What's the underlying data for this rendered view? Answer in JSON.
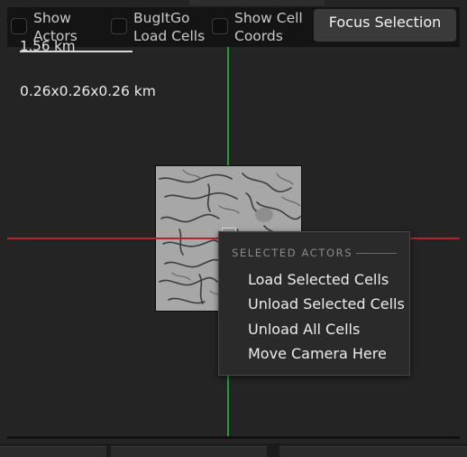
{
  "toolbar": {
    "show_actors_label": "Show Actors",
    "bugitgo_label": "BugItGo Load Cells",
    "show_cell_coords_label": "Show Cell Coords",
    "focus_selection_label": "Focus Selection"
  },
  "viewport": {
    "scale_label": "1.56 km",
    "extent_label": "0.26x0.26x0.26 km"
  },
  "context_menu": {
    "header": "SELECTED ACTORS",
    "items": [
      "Load Selected Cells",
      "Unload Selected Cells",
      "Unload All Cells",
      "Move Camera Here"
    ]
  },
  "colors": {
    "y_axis": "#1fa32b",
    "x_axis": "#b0262a",
    "background": "#242424",
    "menu_bg": "#2a2a2a"
  }
}
